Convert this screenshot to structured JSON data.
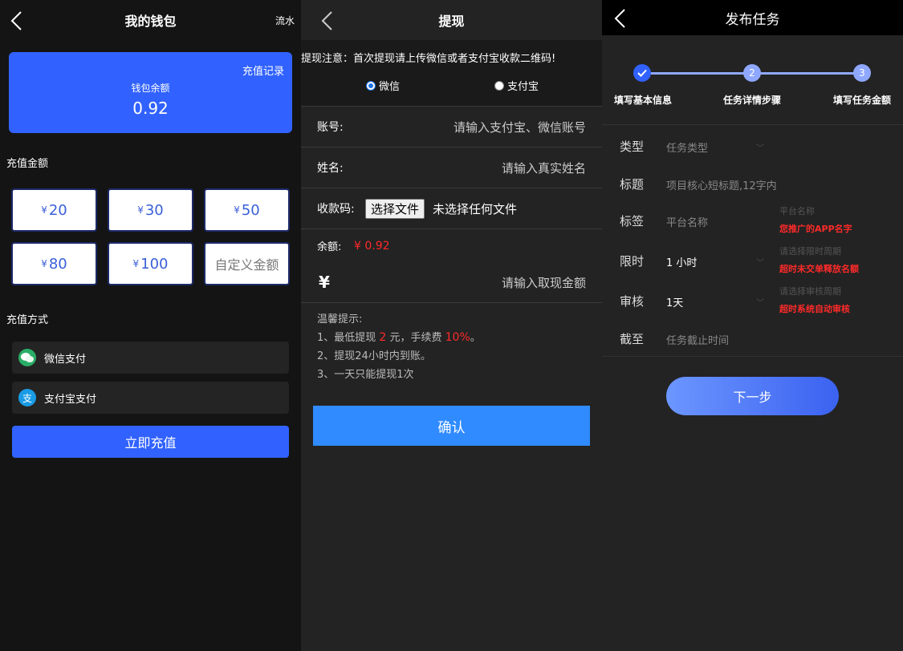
{
  "wallet": {
    "title": "我的钱包",
    "flow_label": "流水",
    "recharge_record": "充值记录",
    "balance_label": "钱包余额",
    "balance_value": "0.92",
    "amount_section": "充值金额",
    "currency": "¥",
    "amounts": [
      "20",
      "30",
      "50",
      "80",
      "100"
    ],
    "custom_placeholder": "自定义金额",
    "method_section": "充值方式",
    "methods": [
      "微信支付",
      "支付宝支付"
    ],
    "submit_label": "立即充值"
  },
  "withdraw": {
    "title": "提现",
    "notice": "提现注意：首次提现请上传微信或者支付宝收款二维码!",
    "options": [
      "微信",
      "支付宝"
    ],
    "account_label": "账号:",
    "account_placeholder": "请输入支付宝、微信账号",
    "name_label": "姓名:",
    "name_placeholder": "请输入真实姓名",
    "qr_label": "收款码:",
    "file_button": "选择文件",
    "file_status": "未选择任何文件",
    "balance_label": "余额:",
    "balance_value": "¥ 0.92",
    "yen": "¥",
    "amount_placeholder": "请输入取现金额",
    "tips_title": "温馨提示:",
    "tip1_pre": "1、最低提现",
    "tip1_min": "2",
    "tip1_mid": "元，手续费",
    "tip1_fee": "10%",
    "tip1_end": "。",
    "tip2": "2、提现24小时内到账。",
    "tip3": "3、一天只能提现1次",
    "confirm_label": "确认"
  },
  "publish": {
    "title": "发布任务",
    "steps": [
      "填写基本信息",
      "任务详情步骤",
      "填写任务金额"
    ],
    "step_nums": [
      "2",
      "3"
    ],
    "rows": [
      {
        "label": "类型",
        "value": "任务类型"
      },
      {
        "label": "标题",
        "value": "项目核心短标题,12字内"
      },
      {
        "label": "标签",
        "value": "平台名称"
      },
      {
        "label": "限时",
        "value": "1 小时"
      },
      {
        "label": "审核",
        "value": "1天"
      },
      {
        "label": "截至",
        "value": "任务截止时间"
      }
    ],
    "hints": [
      {
        "gray": "平台名称",
        "red": "您推广的APP名字"
      },
      {
        "gray": "请选择限时周期",
        "red": "超时未交单释放名额"
      },
      {
        "gray": "请选择审核周期",
        "red": "超时系统自动审核"
      }
    ],
    "next_label": "下一步"
  }
}
